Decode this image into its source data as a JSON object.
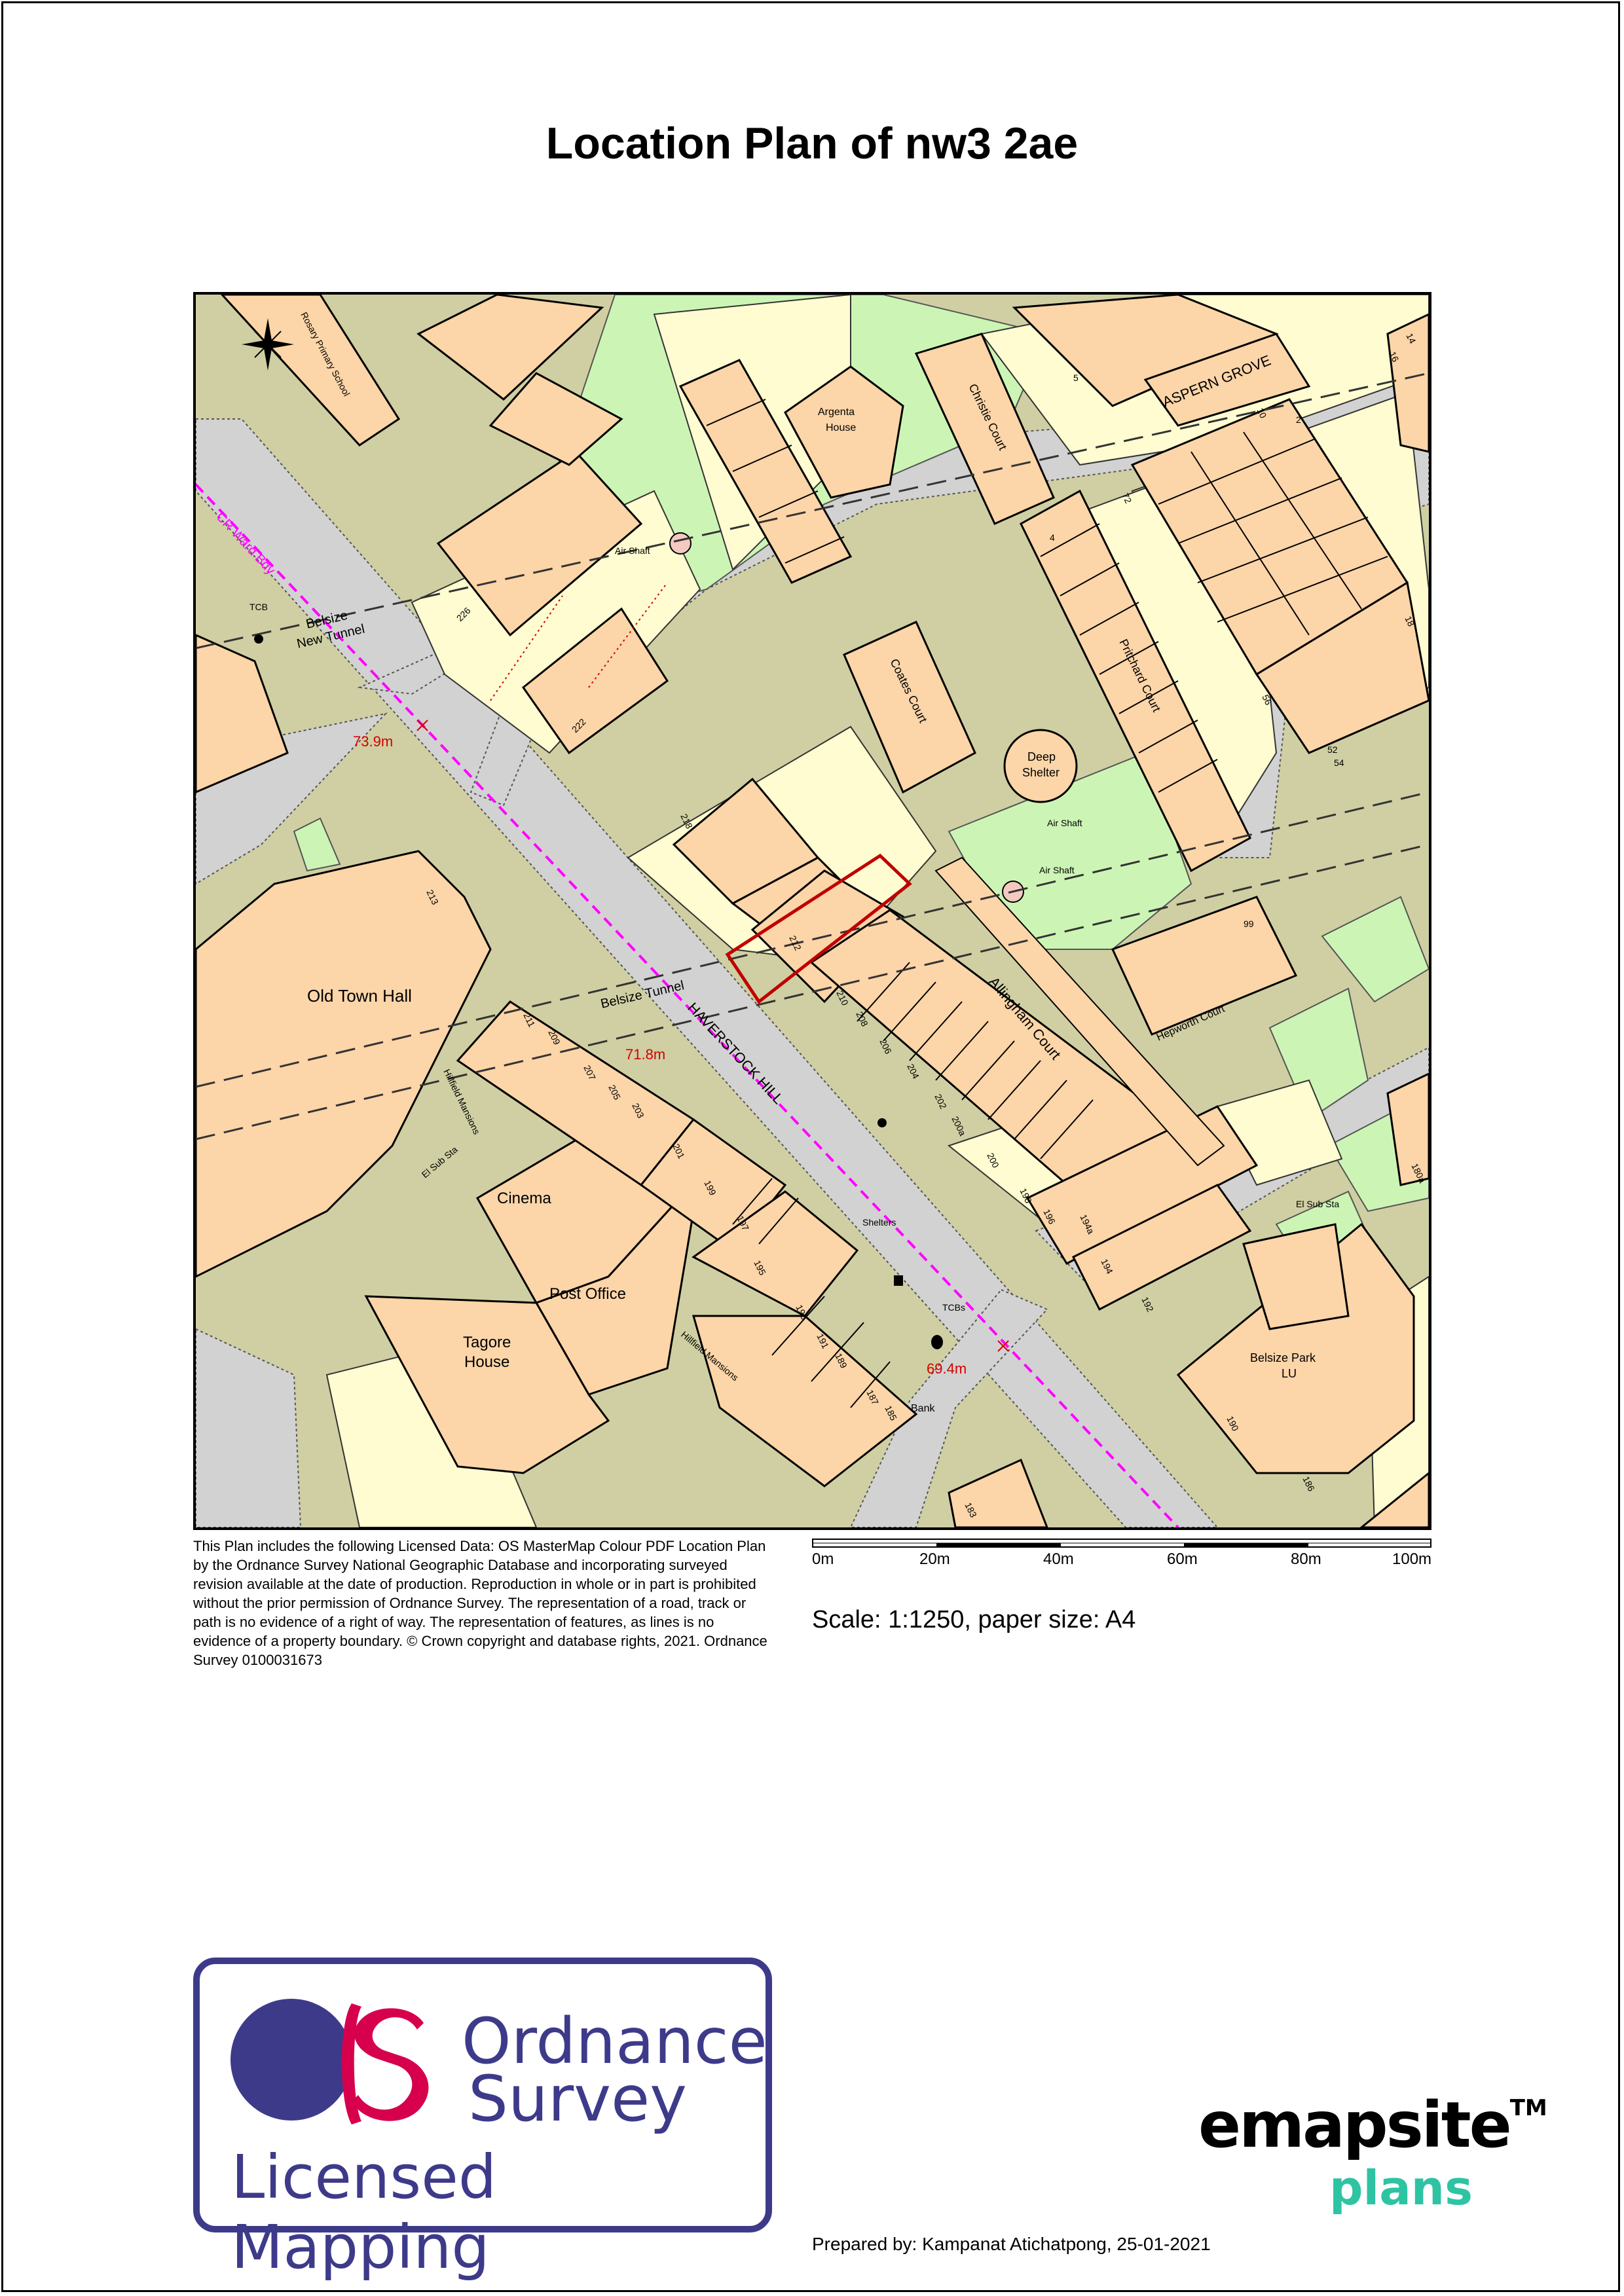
{
  "title": "Location Plan of nw3 2ae",
  "licence_text": "This Plan includes the following Licensed Data: OS MasterMap Colour PDF Location Plan by the Ordnance Survey National Geographic Database and incorporating surveyed revision available at the date of production. Reproduction in whole or in part is prohibited without the prior permission of Ordnance Survey. The representation of a road, track or path is no evidence of a right of way. The representation of features, as lines is no evidence of a property boundary. © Crown copyright and database rights, 2021. Ordnance Survey 0100031673",
  "scale_bar": {
    "labels": [
      "0m",
      "20m",
      "40m",
      "60m",
      "80m",
      "100m"
    ]
  },
  "scale_text": "Scale: 1:1250, paper size: A4",
  "prepared_by": "Prepared by: Kampanat Atichatpong, 25-01-2021",
  "os_logo": {
    "line1": "Ordnance",
    "line2": "Survey",
    "line3": "Licensed Mapping"
  },
  "emapsite_logo": {
    "brand": "emapsite",
    "tm": "TM",
    "sub": "plans"
  },
  "colors": {
    "building": "#fcd5a8",
    "garden": "#fefcd0",
    "green": "#ccf5b5",
    "road": "#d2d2d2",
    "ground": "#cfcfa3",
    "site_boundary": "#c00000",
    "spot_height": "#d40000",
    "ward_boundary": "#ff00ff",
    "os_purple": "#3e3a8a",
    "os_pink": "#d6004d",
    "emapsite_green": "#2ec4a3"
  },
  "map_labels": {
    "old_town_hall": "Old Town Hall",
    "cinema": "Cinema",
    "post_office": "Post Office",
    "tagore_line1": "Tagore",
    "tagore_line2": "House",
    "haverstock_hill": "HAVERSTOCK HILL",
    "aspern_grove": "ASPERN GROVE",
    "belsize_tunnel": "Belsize Tunnel",
    "belsize_new_tunnel_1": "Belsize",
    "belsize_new_tunnel_2": "New Tunnel",
    "allingham_court": "Allingham Court",
    "pritchard_court": "Pritchard Court",
    "coates_court": "Coates Court",
    "christie_court": "Christie Court",
    "hepworth_court": "Hepworth Court",
    "argenta_1": "Argenta",
    "argenta_2": "House",
    "deep_shelter_1": "Deep",
    "deep_shelter_2": "Shelter",
    "air_shaft": "Air Shaft",
    "belsize_park_1": "Belsize Park",
    "belsize_park_2": "LU",
    "rosary_school": "Rosary Primary School",
    "cr_ward_bdy": "CR Ward Bdy",
    "shelters": "Shelters",
    "bank": "Bank",
    "tcb": "TCB",
    "tcbs": "TCBs",
    "el_sub_sta": "El Sub Sta",
    "hillfield_mansions": "Hillfield Mansions",
    "spot_1": "73.9m",
    "spot_2": "71.8m",
    "spot_3": "69.4m"
  },
  "house_numbers": {
    "n213": "213",
    "n211": "211",
    "n209": "209",
    "n207": "207",
    "n205": "205",
    "n203": "203",
    "n201": "201",
    "n199": "199",
    "n197": "197",
    "n195": "195",
    "n193": "193",
    "n191": "191",
    "n189": "189",
    "n187": "187",
    "n185": "185",
    "n222": "222",
    "n226": "226",
    "n218": "218",
    "n212": "212",
    "n210": "210",
    "n208": "208",
    "n206": "206",
    "n204": "204",
    "n202": "202",
    "n200a": "200a",
    "n200": "200",
    "n198": "198",
    "n196": "196",
    "n194a": "194a",
    "n194": "194",
    "n192": "192",
    "n190": "190",
    "n186": "186",
    "n180a": "180a",
    "n99": "99",
    "n52": "52",
    "n54": "54",
    "n5": "5",
    "n14": "14",
    "n16": "16",
    "n18": "18",
    "n4": "4",
    "n72": "72",
    "n56": "56",
    "n10": "10",
    "n2": "2",
    "n183": "183"
  }
}
